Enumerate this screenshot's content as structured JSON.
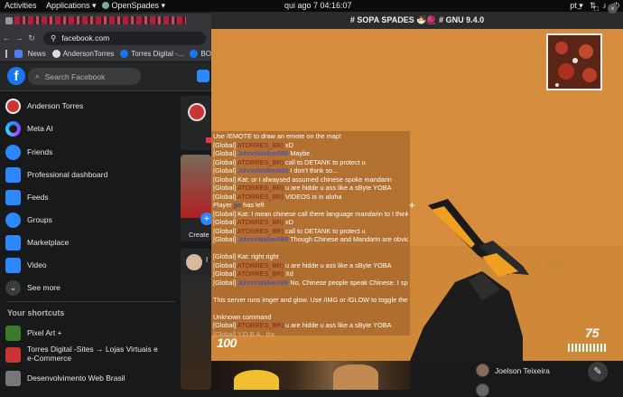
{
  "topbar": {
    "activities": "Activities",
    "applications": "Applications ▾",
    "app_name": "OpenSpades ▾",
    "clock": "qui ago 7  04:16:07",
    "layout": "pt ▾"
  },
  "browser": {
    "url": "facebook.com",
    "bookmarks": [
      {
        "label": "News",
        "color": "#4f7df3"
      },
      {
        "label": "AndersonTorres",
        "color": "#888888"
      },
      {
        "label": "Torres Digital -...",
        "color": "#1877f2"
      },
      {
        "label": "BO",
        "color": "#1877f2"
      }
    ]
  },
  "facebook": {
    "logo": "f",
    "search_placeholder": "Search Facebook",
    "sidebar": [
      {
        "label": "Anderson Torres",
        "icon": "avatar-icon",
        "color": "#c33"
      },
      {
        "label": "Meta AI",
        "icon": "meta-ai-icon",
        "color": "#2d88ff"
      },
      {
        "label": "Friends",
        "icon": "friends-icon",
        "color": "#2d88ff"
      },
      {
        "label": "Professional dashboard",
        "icon": "dashboard-icon",
        "color": "#2d88ff"
      },
      {
        "label": "Feeds",
        "icon": "feeds-icon",
        "color": "#2d88ff"
      },
      {
        "label": "Groups",
        "icon": "groups-icon",
        "color": "#2d88ff"
      },
      {
        "label": "Marketplace",
        "icon": "marketplace-icon",
        "color": "#2d88ff"
      },
      {
        "label": "Video",
        "icon": "video-icon",
        "color": "#2d88ff"
      },
      {
        "label": "See more",
        "icon": "chevron-down-icon",
        "color": "#3a3b3c"
      }
    ],
    "shortcuts_title": "Your shortcuts",
    "shortcuts": [
      {
        "label": "Pixel Art +",
        "color": "#3b7a2a"
      },
      {
        "label": "Torres Digital -Sites → Lojas Virtuais e",
        "label2": "e-Commerce",
        "color": "#c33"
      },
      {
        "label": "Desenvolvimento Web Brasil",
        "color": "#777"
      }
    ],
    "feed": {
      "create_story": "Create s",
      "post_initial": "I"
    },
    "contacts": [
      {
        "name": "Joelson Teixeira"
      }
    ]
  },
  "game": {
    "title": "# SOPA SPADES 🍜🧶 # GNU 9.4.0",
    "hp": "100",
    "ammo": "75",
    "chat": [
      {
        "prefix": "",
        "name": "",
        "text": "Use /EMOTE to draw an emote on the map!",
        "cls": ""
      },
      {
        "prefix": "[Global] ",
        "name": "ATORRES_BR)",
        "text": " xD",
        "cls": "p1"
      },
      {
        "prefix": "[Global] ",
        "name": "JohnniWalker888",
        "text": " Maybe.",
        "cls": "p2"
      },
      {
        "prefix": "[Global] ",
        "name": "ATORRES_BR)",
        "text": " call to DETANK to protect u",
        "cls": "p1"
      },
      {
        "prefix": "[Global] ",
        "name": "JohnniWalker888",
        "text": " I don't think so...",
        "cls": "p2"
      },
      {
        "prefix": "[Global] Kat: ",
        "name": "",
        "text": "or I alwaysed assumed chinese spoke mandarin",
        "cls": ""
      },
      {
        "prefix": "[Global] ",
        "name": "ATORRES_BR)",
        "text": " u are hidde u ass like a sByte YOBA",
        "cls": "p1"
      },
      {
        "prefix": "[Global] ",
        "name": "ATORRES_BR)",
        "text": " VIDEOS is in aloha",
        "cls": "p1"
      },
      {
        "prefix": "Player ",
        "name": "jjw",
        "text": " has left",
        "cls": "p3"
      },
      {
        "prefix": "[Global] Kat: ",
        "name": "",
        "text": "I mean chinese call there language mandarin to I think",
        "cls": ""
      },
      {
        "prefix": "[Global] ",
        "name": "ATORRES_BR)",
        "text": " xD",
        "cls": "p1"
      },
      {
        "prefix": "[Global] ",
        "name": "ATORRES_BR)",
        "text": " call to DETANK to protect u",
        "cls": "p1"
      },
      {
        "prefix": "[Global] ",
        "name": "JohnniWalker888",
        "text": " Though Chinese and Mandarin are obviously simlar to eachother",
        "cls": "p2"
      },
      {
        "prefix": "",
        "name": "",
        "text": "",
        "cls": ""
      },
      {
        "prefix": "[Global] Kat: ",
        "name": "",
        "text": "right right",
        "cls": ""
      },
      {
        "prefix": "[Global] ",
        "name": "ATORRES_BR)",
        "text": " u are hidde u ass like a sByte YOBA",
        "cls": "p1"
      },
      {
        "prefix": "[Global] ",
        "name": "ATORRES_BR)",
        "text": " Xd",
        "cls": "p1"
      },
      {
        "prefix": "[Global] ",
        "name": "JohnniWalker888",
        "text": " No, Chinese people speak Chinese. I speak Mandarin because Taiwanese people do.",
        "cls": "p2"
      },
      {
        "prefix": "",
        "name": "",
        "text": "",
        "cls": ""
      },
      {
        "prefix": "",
        "name": "",
        "text": "This server runs imger and glow. Use /IMG or /GLOW to toggle them.",
        "cls": ""
      },
      {
        "prefix": "",
        "name": "",
        "text": "",
        "cls": ""
      },
      {
        "prefix": "",
        "name": "",
        "text": "Unknown command",
        "cls": ""
      },
      {
        "prefix": "[Global] ",
        "name": "ATORRES_BR)",
        "text": " u are hidde u ass like a sByte YOBA",
        "cls": "p1"
      },
      {
        "prefix": "[Global] ",
        "name": "",
        "text": "Y.O.B.A.. thx",
        "cls": "faded"
      }
    ]
  }
}
